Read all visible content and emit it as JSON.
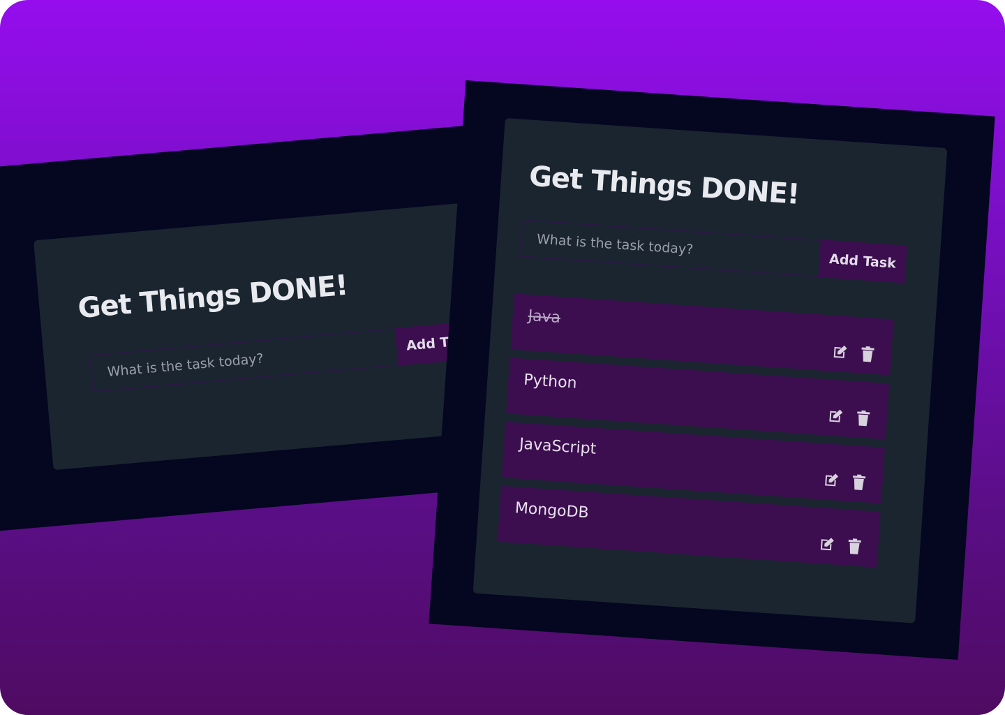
{
  "colors": {
    "background_top": "#950ded",
    "background_bottom": "#4f0b62",
    "frame": "#050620",
    "card": "#1a2530",
    "task_bg": "#3c0e4f",
    "text": "#e9eaef"
  },
  "left_app": {
    "title": "Get Things DONE!",
    "input_placeholder": "What is the task today?",
    "add_button": "Add Task"
  },
  "right_app": {
    "title": "Get Things DONE!",
    "input_placeholder": "What is the task today?",
    "add_button": "Add Task",
    "tasks": [
      {
        "name": "Java",
        "completed": true
      },
      {
        "name": "Python",
        "completed": false
      },
      {
        "name": "JavaScript",
        "completed": false
      },
      {
        "name": "MongoDB",
        "completed": false
      }
    ],
    "icons": {
      "edit": "edit-icon",
      "delete": "trash-icon"
    }
  }
}
